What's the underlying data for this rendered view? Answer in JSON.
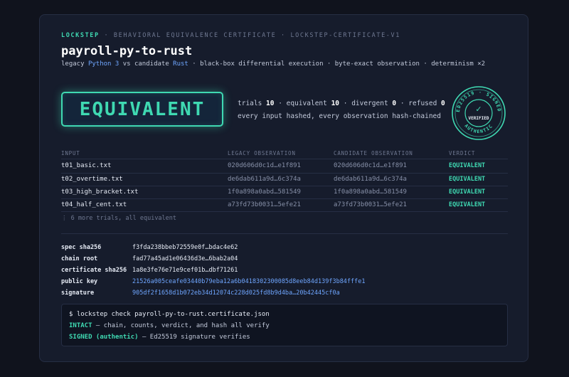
{
  "header": {
    "brand": "LOCKSTEP",
    "kicker_rest": " · BEHAVIORAL EQUIVALENCE CERTIFICATE · LOCKSTEP-CERTIFICATE-V1",
    "title": "payroll-py-to-rust",
    "subtitle": {
      "legacy_prefix": "legacy ",
      "legacy_lang": "Python 3",
      "vs_candidate": " vs candidate ",
      "candidate_lang": "Rust",
      "rest": " · black-box differential execution · byte-exact observation · determinism ×2"
    }
  },
  "verdict": {
    "label": "EQUIVALENT"
  },
  "stats": {
    "trials_label": "trials ",
    "trials": "10",
    "equivalent_label": " · equivalent ",
    "equivalent": "10",
    "divergent_label": " · divergent ",
    "divergent": "0",
    "refused_label": " · refused ",
    "refused": "0",
    "note": "every input hashed, every observation hash-chained"
  },
  "seal": {
    "ring_top": "ED25519 · SIGNED",
    "ring_bottom": "AUTHENTIC",
    "check": "✓",
    "center": "VERIFIED",
    "color": "#3fd9b2"
  },
  "table": {
    "columns": [
      "INPUT",
      "LEGACY OBSERVATION",
      "CANDIDATE OBSERVATION",
      "VERDICT"
    ],
    "rows": [
      {
        "input": "t01_basic.txt",
        "legacy": "020d606d0c1d…e1f891",
        "candidate": "020d606d0c1d…e1f891",
        "verdict": "EQUIVALENT"
      },
      {
        "input": "t02_overtime.txt",
        "legacy": "de6dab611a9d…6c374a",
        "candidate": "de6dab611a9d…6c374a",
        "verdict": "EQUIVALENT"
      },
      {
        "input": "t03_high_bracket.txt",
        "legacy": "1f0a898a0abd…581549",
        "candidate": "1f0a898a0abd…581549",
        "verdict": "EQUIVALENT"
      },
      {
        "input": "t04_half_cent.txt",
        "legacy": "a73fd73b0031…5efe21",
        "candidate": "a73fd73b0031…5efe21",
        "verdict": "EQUIVALENT"
      }
    ],
    "more": "⋮ 6 more trials, all equivalent"
  },
  "details": [
    {
      "label": "spec sha256",
      "value": "f3fda238bbeb72559e0f…bdac4e62"
    },
    {
      "label": "chain root",
      "value": "fad77a45ad1e06436d3e…6bab2a04"
    },
    {
      "label": "certificate sha256",
      "value": "1a8e3fe76e71e9cef01b…dbf71261"
    },
    {
      "label": "public key",
      "value": "21526a005ceafe03440b79eba12a6b0418302300085d8eeb84d139f3b84fffe1"
    },
    {
      "label": "signature",
      "value": "905df2f1658d1b072eb34d12074c228d025fd8b9d4ba…20b42445cf0a"
    }
  ],
  "terminal": {
    "command": "$ lockstep check payroll-py-to-rust.certificate.json",
    "line2_key": "INTACT",
    "line2_rest": " — chain, counts, verdict, and hash all verify",
    "line3_key": "SIGNED (authentic)",
    "line3_rest": " — Ed25519 signature verifies"
  },
  "colors": {
    "accent": "#3fd9b2",
    "link": "#6fa6ff",
    "card_bg": "#161c2c",
    "page_bg": "#10131d"
  }
}
